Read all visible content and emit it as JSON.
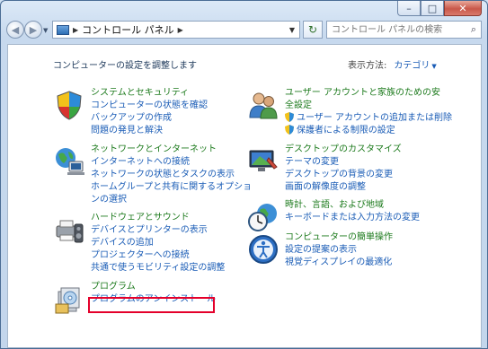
{
  "address": {
    "breadcrumb": "コントロール パネル"
  },
  "search": {
    "placeholder": "コントロール パネルの検索"
  },
  "main": {
    "title": "コンピューターの設定を調整します",
    "view_by_label": "表示方法:",
    "view_by_value": "カテゴリ"
  },
  "categories": [
    {
      "title": "システムとセキュリティ",
      "links": [
        "コンピューターの状態を確認",
        "バックアップの作成",
        "問題の発見と解決"
      ]
    },
    {
      "title": "ネットワークとインターネット",
      "links": [
        "インターネットへの接続",
        "ネットワークの状態とタスクの表示",
        "ホームグループと共有に関するオプションの選択"
      ]
    },
    {
      "title": "ハードウェアとサウンド",
      "links": [
        "デバイスとプリンターの表示",
        "デバイスの追加",
        "プロジェクターへの接続",
        "共通で使うモビリティ設定の調整"
      ]
    },
    {
      "title": "プログラム",
      "links": [
        "プログラムのアンインストール"
      ]
    },
    {
      "title": "ユーザー アカウントと家族のための安全設定",
      "links": [
        "ユーザー アカウントの追加または削除",
        "保護者による制限の設定"
      ]
    },
    {
      "title": "デスクトップのカスタマイズ",
      "links": [
        "テーマの変更",
        "デスクトップの背景の変更",
        "画面の解像度の調整"
      ]
    },
    {
      "title": "時計、言語、および地域",
      "links": [
        "キーボードまたは入力方法の変更"
      ]
    },
    {
      "title": "コンピューターの簡単操作",
      "links": [
        "設定の提案の表示",
        "視覚ディスプレイの最適化"
      ]
    }
  ],
  "colors": {
    "link": "#1a5cb6",
    "category": "#1c7a1c",
    "highlight": "#e4002b"
  },
  "icons": [
    "system-security-icon",
    "network-icon",
    "hardware-sound-icon",
    "programs-icon",
    "user-accounts-icon",
    "desktop-icon",
    "clock-globe-icon",
    "ease-of-access-icon",
    "uac-shield-icon"
  ]
}
